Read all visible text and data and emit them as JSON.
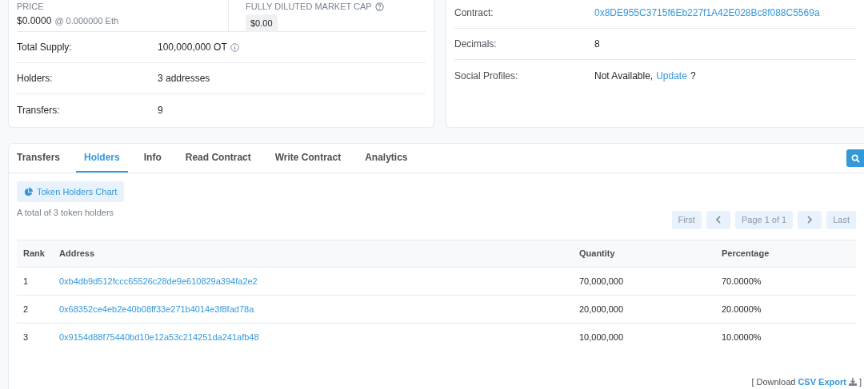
{
  "overview": {
    "price": {
      "label": "PRICE",
      "value": "$0.0000",
      "eth": "@ 0.000000 Eth"
    },
    "market_cap": {
      "label": "FULLY DILUTED MARKET CAP",
      "value": "$0.00"
    },
    "rows": [
      {
        "label": "Total Supply:",
        "value": "100,000,000 OT",
        "info": true
      },
      {
        "label": "Holders:",
        "value": "3 addresses",
        "info": false
      },
      {
        "label": "Transfers:",
        "value": "9",
        "info": false
      }
    ]
  },
  "profile": {
    "rows": [
      {
        "label": "Contract:",
        "value": "0x8DE955C3715f6Eb227f1A42E028Bc8f088C5569a",
        "kind": "link"
      },
      {
        "label": "Decimals:",
        "value": "8",
        "kind": "text"
      },
      {
        "label": "Social Profiles:",
        "value": "Not Available,",
        "link": "Update",
        "suffix": "?",
        "kind": "social"
      }
    ]
  },
  "tabs": [
    {
      "label": "Transfers",
      "selected": false
    },
    {
      "label": "Holders",
      "selected": true
    },
    {
      "label": "Info",
      "selected": false
    },
    {
      "label": "Read Contract",
      "selected": false
    },
    {
      "label": "Write Contract",
      "selected": false
    },
    {
      "label": "Analytics",
      "selected": false
    }
  ],
  "chart_button": "Token Holders Chart",
  "summary": "A total of 3 token holders",
  "pagination": [
    {
      "kind": "text",
      "label": "First",
      "disabled": true
    },
    {
      "kind": "prev",
      "disabled": true
    },
    {
      "kind": "text",
      "label": "Page 1 of 1",
      "disabled": true
    },
    {
      "kind": "next",
      "disabled": true
    },
    {
      "kind": "text",
      "label": "Last",
      "disabled": true
    }
  ],
  "table": {
    "columns": [
      "Rank",
      "Address",
      "Quantity",
      "Percentage"
    ],
    "rows": [
      {
        "rank": "1",
        "address": "0xb4db9d512fccc65526c28de9e610829a394fa2e2",
        "quantity": "70,000,000",
        "percentage": "70.0000%"
      },
      {
        "rank": "2",
        "address": "0x68352ce4eb2e40b08ff33e271b4014e3f8fad78a",
        "quantity": "20,000,000",
        "percentage": "20.0000%"
      },
      {
        "rank": "3",
        "address": "0x9154d88f75440bd10e12a53c214251da241afb48",
        "quantity": "10,000,000",
        "percentage": "10.0000%"
      }
    ]
  },
  "footer": {
    "prefix": "[ Download",
    "link": "CSV Export",
    "suffix": "]"
  }
}
